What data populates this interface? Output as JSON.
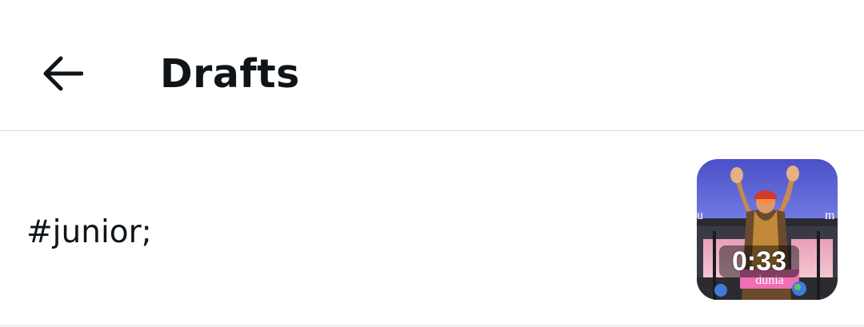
{
  "header": {
    "back_icon": "arrow-left-icon",
    "title": "Drafts"
  },
  "drafts": [
    {
      "text": "#junior;",
      "thumbnail": {
        "duration": "0:33",
        "caption_left": "u",
        "caption_right": "m",
        "banner_text": "dunia"
      }
    }
  ],
  "colors": {
    "text": "#0f1419",
    "divider": "#d9dde1",
    "background": "#ffffff"
  }
}
